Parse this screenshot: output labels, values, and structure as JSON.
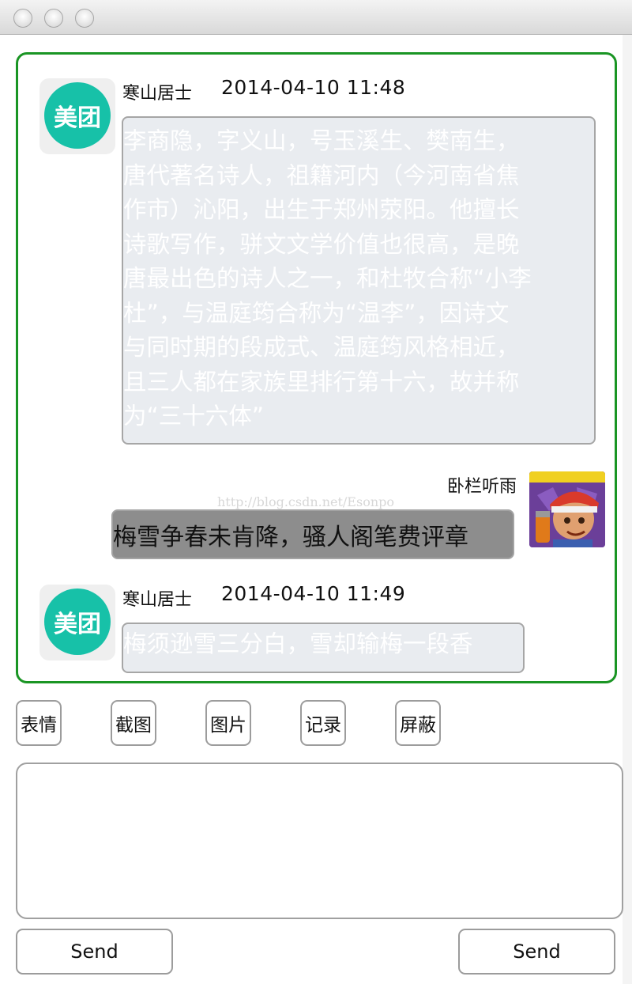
{
  "window": {
    "traffic_lights": [
      "close",
      "minimize",
      "zoom"
    ]
  },
  "messages": [
    {
      "sender": "寒山居士",
      "time": "2014-04-10 11:48",
      "avatar_text": "美团",
      "lines": [
        "李商隐，字义山，号玉溪生、樊南生，",
        "唐代著名诗人，祖籍河内（今河南省焦",
        "作市）沁阳，出生于郑州荥阳。他擅长",
        "诗歌写作，骈文文学价值也很高，是晚",
        "唐最出色的诗人之一，和杜牧合称“小李",
        "杜”，与温庭筠合称为“温李”，因诗文",
        "与同时期的段成式、温庭筠风格相近，",
        "且三人都在家族里排行第十六，故并称",
        "为“三十六体”"
      ]
    },
    {
      "sender": "卧栏听雨",
      "text": "梅雪争春未肯降，骚人阁笔费评章"
    },
    {
      "sender": "寒山居士",
      "time": "2014-04-10 11:49",
      "avatar_text": "美团",
      "text": "梅须逊雪三分白，雪却输梅一段香"
    }
  ],
  "watermark": "http://blog.csdn.net/Esonpo",
  "toolbar": [
    "表情",
    "截图",
    "图片",
    "记录",
    "屏蔽"
  ],
  "input": {
    "value": ""
  },
  "send_buttons": [
    "Send",
    "Send"
  ],
  "colors": {
    "panel_border": "#1a9524",
    "incoming_bubble": "#e9ecf0",
    "outgoing_bubble": "#8d8d8d",
    "avatar_teal": "#17c1a8"
  }
}
